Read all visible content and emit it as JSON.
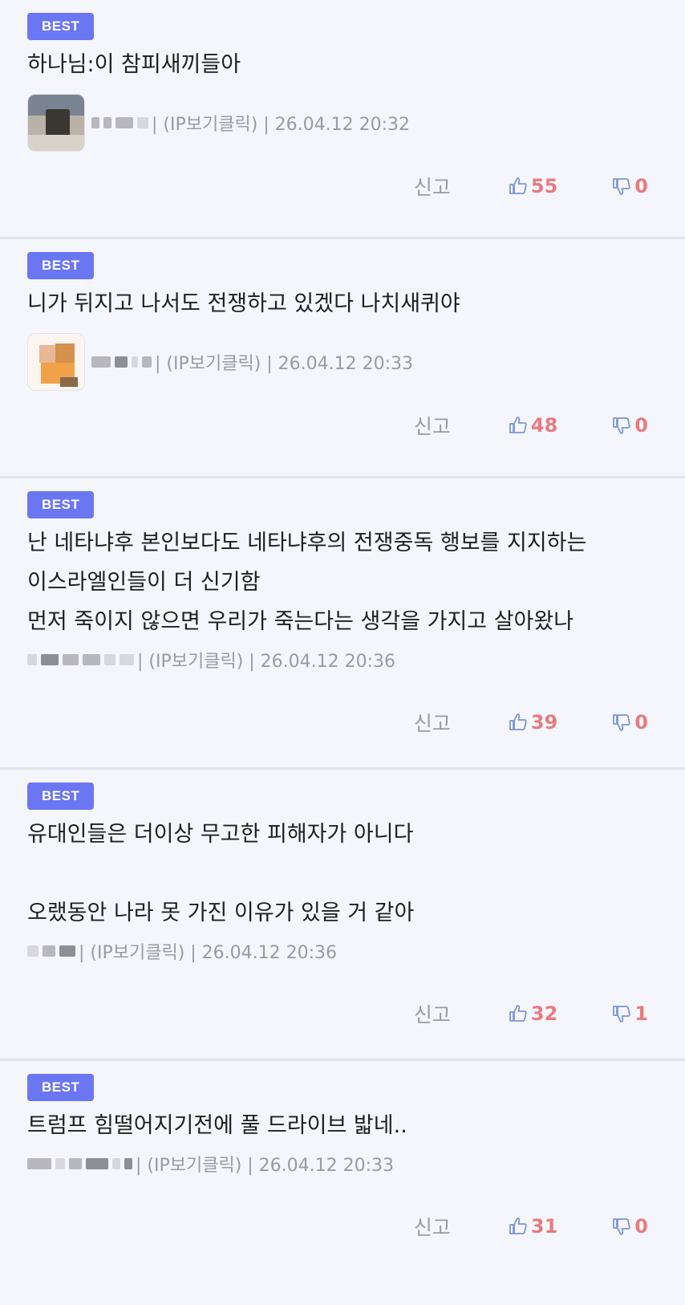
{
  "comments": [
    {
      "badge": "BEST",
      "lines": [
        "하나님:이 참피새끼들아"
      ],
      "has_avatar": true,
      "meta": "| (IP보기클릭) | 26.04.12 20:32",
      "report": "신고",
      "likes": "55",
      "dislikes": "0"
    },
    {
      "badge": "BEST",
      "lines": [
        "니가 뒤지고 나서도 전쟁하고 있겠다 나치새퀴야"
      ],
      "has_avatar": true,
      "meta": "| (IP보기클릭) | 26.04.12 20:33",
      "report": "신고",
      "likes": "48",
      "dislikes": "0"
    },
    {
      "badge": "BEST",
      "lines": [
        "난 네타냐후 본인보다도 네타냐후의 전쟁중독 행보를 지지하는",
        "이스라엘인들이 더 신기함",
        "먼저 죽이지 않으면 우리가 죽는다는 생각을 가지고 살아왔나"
      ],
      "has_avatar": false,
      "meta": "| (IP보기클릭) | 26.04.12 20:36",
      "report": "신고",
      "likes": "39",
      "dislikes": "0"
    },
    {
      "badge": "BEST",
      "lines": [
        "유대인들은 더이상 무고한 피해자가 아니다",
        "",
        "오랬동안 나라 못 가진 이유가 있을 거 같아"
      ],
      "has_avatar": false,
      "meta": "| (IP보기클릭) | 26.04.12 20:36",
      "report": "신고",
      "likes": "32",
      "dislikes": "1"
    },
    {
      "badge": "BEST",
      "lines": [
        "트럼프 힘떨어지기전에 풀 드라이브 밟네.."
      ],
      "has_avatar": false,
      "meta": "| (IP보기클릭) | 26.04.12 20:33",
      "report": "신고",
      "likes": "31",
      "dislikes": "0"
    }
  ],
  "icons": {
    "like": "thumbs-up-icon",
    "dislike": "thumbs-down-icon"
  },
  "colors": {
    "badge": "#6b76f3",
    "vote": "#e87b80",
    "icon": "#7b97d6"
  }
}
